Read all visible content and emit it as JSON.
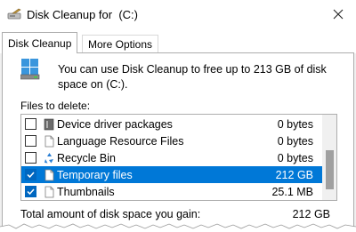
{
  "window": {
    "title": "Disk Cleanup for  (C:)",
    "icon": "disk-cleanup-icon",
    "close_icon": "close-icon"
  },
  "tabs": [
    {
      "label": "Disk Cleanup",
      "active": true
    },
    {
      "label": "More Options",
      "active": false
    }
  ],
  "info": {
    "icon": "drive-icon",
    "text": "You can use Disk Cleanup to free up to 213 GB of disk space on  (C:)."
  },
  "files_to_delete_label": "Files to delete:",
  "files": [
    {
      "label": "Device driver packages",
      "size": "0 bytes",
      "checked": false,
      "selected": false,
      "icon": "driver-package-icon"
    },
    {
      "label": "Language Resource Files",
      "size": "0 bytes",
      "checked": false,
      "selected": false,
      "icon": "file-icon"
    },
    {
      "label": "Recycle Bin",
      "size": "0 bytes",
      "checked": false,
      "selected": false,
      "icon": "recycle-bin-icon"
    },
    {
      "label": "Temporary files",
      "size": "212 GB",
      "checked": true,
      "selected": true,
      "icon": "file-icon"
    },
    {
      "label": "Thumbnails",
      "size": "25.1 MB",
      "checked": true,
      "selected": false,
      "icon": "file-icon"
    }
  ],
  "total": {
    "label": "Total amount of disk space you gain:",
    "value": "212 GB"
  },
  "colors": {
    "selection": "#0078d7",
    "checkbox_checked": "#0067c0"
  }
}
